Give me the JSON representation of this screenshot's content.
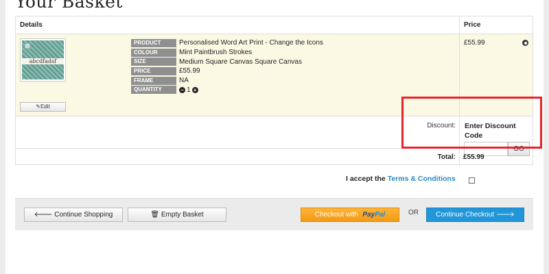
{
  "page": {
    "title": "Your Basket"
  },
  "table": {
    "details_header": "Details",
    "price_header": "Price"
  },
  "item": {
    "thumbnail_text": "abcdfadsf",
    "edit_label": "Edit",
    "properties": [
      {
        "label": "PRODUCT",
        "value": "Personalised Word Art Print - Change the Icons"
      },
      {
        "label": "COLOUR",
        "value": "Mint Paintbrush Strokes"
      },
      {
        "label": "SIZE",
        "value": "Medium Square Canvas Square Canvas"
      },
      {
        "label": "PRICE",
        "value": "£55.99"
      },
      {
        "label": "FRAME",
        "value": "NA"
      },
      {
        "label": "QUANTITY",
        "value": "1"
      }
    ],
    "price": "£55.99"
  },
  "discount": {
    "label": "Discount:",
    "title": "Enter Discount Code",
    "input_value": "",
    "go_label": "GO"
  },
  "total": {
    "label": "Total:",
    "value": "£55.99"
  },
  "terms": {
    "prefix": "I accept the",
    "link": "Terms & Conditions"
  },
  "actions": {
    "continue_shopping": "Continue Shopping",
    "empty_basket": "Empty Basket",
    "checkout_with": "Checkout with",
    "paypal_pay": "Pay",
    "paypal_pal": "Pal",
    "or": "OR",
    "continue_checkout": "Continue Checkout"
  },
  "colors": {
    "highlight": "#e8222a",
    "checkout_blue": "#2196d9",
    "paypal_orange": "#f29a14",
    "link_blue": "#2a87c4"
  }
}
